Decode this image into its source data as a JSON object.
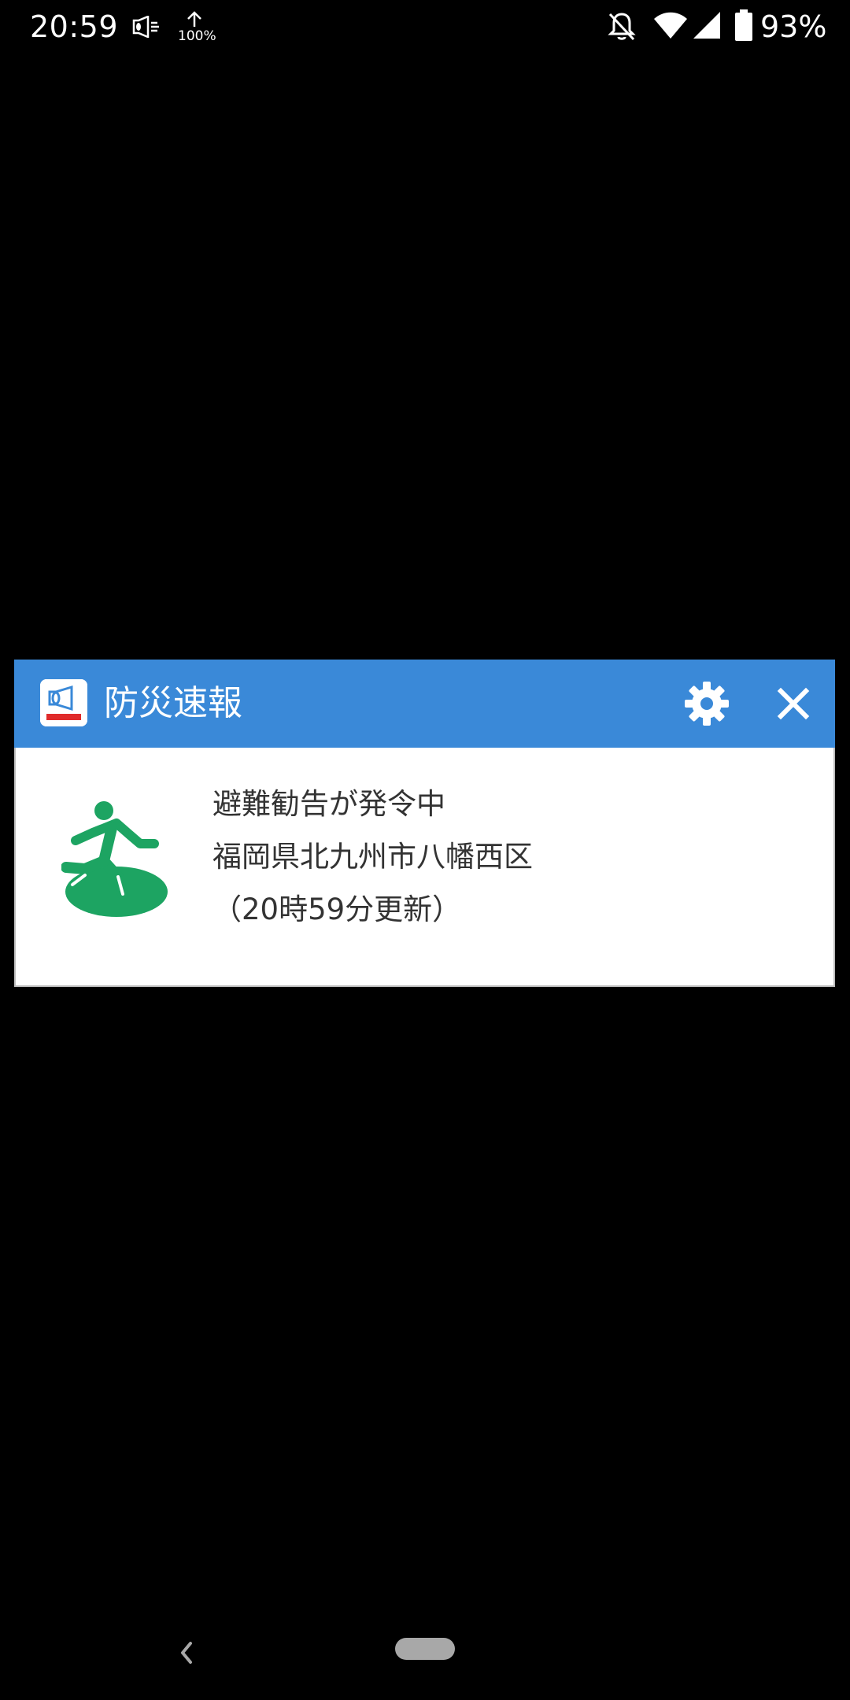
{
  "status_bar": {
    "time": "20:59",
    "umbrella_percent": "100%",
    "battery_percent": "93%",
    "icons": [
      "megaphone-icon",
      "umbrella-icon",
      "bell-off-icon",
      "wifi-icon",
      "signal-icon",
      "battery-icon"
    ]
  },
  "dialog": {
    "app_icon": "bousai-app-icon",
    "title": "防災速報",
    "header_color": "#3a89d8",
    "settings_icon": "gear-icon",
    "close_icon": "close-icon",
    "alert_icon": "evacuation-icon",
    "alert_color": "#1da462",
    "message": {
      "line1": "避難勧告が発令中",
      "line2": "福岡県北九州市八幡西区",
      "line3": "（20時59分更新）"
    }
  },
  "nav_bar": {
    "back_icon": "back-chevron-icon",
    "home_icon": "home-pill-icon"
  }
}
